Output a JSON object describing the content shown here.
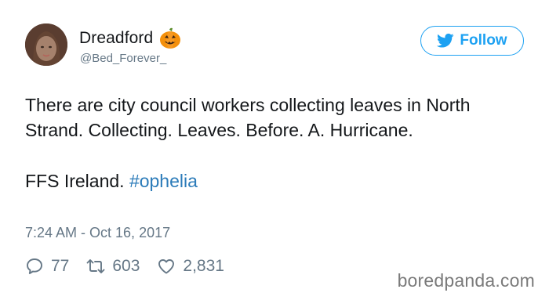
{
  "user": {
    "display_name": "Dreadford",
    "name_emoji": "pumpkin-icon",
    "handle": "@Bed_Forever_"
  },
  "follow_button": {
    "label": "Follow",
    "icon": "twitter-bird-icon",
    "color": "#1da1f2"
  },
  "tweet": {
    "paragraph_1": "There are city council workers collecting leaves in North Strand. Collecting. Leaves. Before. A. Hurricane.",
    "paragraph_2_text": "FFS Ireland. ",
    "hashtag": "#ophelia",
    "hashtag_color": "#2b7bb9",
    "timestamp": "7:24 AM - Oct 16, 2017"
  },
  "actions": {
    "replies": "77",
    "retweets": "603",
    "likes": "2,831"
  },
  "watermark": "boredpanda.com"
}
